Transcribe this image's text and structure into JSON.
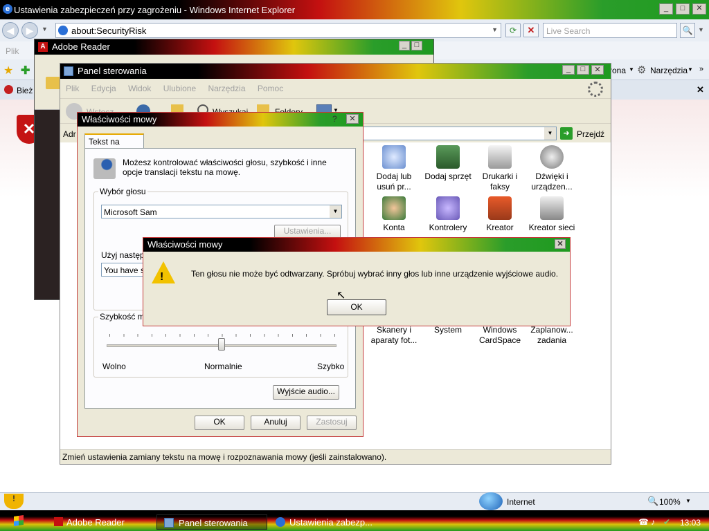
{
  "ie": {
    "title": "Ustawienia zabezpieczeń przy zagrożeniu - Windows Internet Explorer",
    "address": "about:SecurityRisk",
    "search_placeholder": "Live Search",
    "menu_partial": "Plik",
    "tab_partial": "Bież",
    "tools_label": "Narzędzia",
    "page_label_partial": "rona",
    "status_zone": "Internet",
    "zoom": "100%"
  },
  "adobe": {
    "title": "Adobe Reader"
  },
  "cp": {
    "title": "Panel sterowania",
    "menu": [
      "Plik",
      "Edycja",
      "Widok",
      "Ulubione",
      "Narzędzia",
      "Pomoc"
    ],
    "back_label": "Wstecz",
    "search_label": "Wyszukaj",
    "folders_label": "Foldery",
    "address_partial": "Adr",
    "go_label": "Przejdź",
    "items": [
      {
        "label": "Dodaj lub usuń pr...",
        "icon": "add-remove-programs-icon"
      },
      {
        "label": "Dodaj sprzęt",
        "icon": "add-hardware-icon"
      },
      {
        "label": "Drukarki i faksy",
        "icon": "printers-icon"
      },
      {
        "label": "Dźwięki i urządzen...",
        "icon": "sounds-icon"
      },
      {
        "label": "Konta użytkowni...",
        "icon": "user-accounts-icon"
      },
      {
        "label": "Kontrolery gier",
        "icon": "game-controllers-icon"
      },
      {
        "label": "Kreator konfigura...",
        "icon": "network-setup-icon"
      },
      {
        "label": "Kreator sieci bezprzewo...",
        "icon": "wireless-network-icon"
      },
      {
        "label": "Skanery i aparaty fot...",
        "icon": "scanners-icon"
      },
      {
        "label": "System",
        "icon": "system-icon"
      },
      {
        "label": "Windows CardSpace",
        "icon": "cardspace-icon"
      },
      {
        "label": "Zaplanow... zadania",
        "icon": "scheduled-tasks-icon"
      }
    ],
    "status_text": "Zmień ustawienia zamiany tekstu na mowę i rozpoznawania mowy (jeśli zainstalowano)."
  },
  "speech": {
    "title": "Właściwości mowy",
    "tab": "Tekst na mowę",
    "intro": "Możesz kontrolować właściwości głosu, szybkość i inne opcje translacji tekstu na mowę.",
    "voice_group": "Wybór głosu",
    "voice_selected": "Microsoft Sam",
    "settings_btn": "Ustawienia...",
    "preview_label_partial": "Użyj następu",
    "preview_text_partial": "You have se",
    "speed_group_partial": "Szybkość mo",
    "speed_slow": "Wolno",
    "speed_normal": "Normalnie",
    "speed_fast": "Szybko",
    "speed_level": 0.5,
    "audio_btn": "Wyjście audio...",
    "ok": "OK",
    "cancel": "Anuluj",
    "apply": "Zastosuj"
  },
  "alert": {
    "title": "Właściwości mowy",
    "message": "Ten głosu nie może być odtwarzany. Spróbuj wybrać inny głos lub inne urządzenie wyjściowe audio.",
    "ok": "OK"
  },
  "taskbar": {
    "items": [
      "Adobe Reader",
      "Panel sterowania",
      "Ustawienia zabezp..."
    ],
    "clock": "13:03"
  }
}
